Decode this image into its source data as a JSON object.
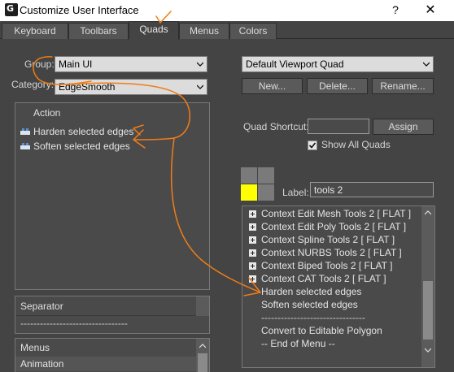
{
  "window": {
    "title": "Customize User Interface",
    "help_label": "?",
    "close_label": "✕"
  },
  "tabs": [
    {
      "label": "Keyboard"
    },
    {
      "label": "Toolbars"
    },
    {
      "label": "Quads",
      "active": true
    },
    {
      "label": "Menus"
    },
    {
      "label": "Colors"
    }
  ],
  "left": {
    "group_label": "Group:",
    "group_value": "Main UI",
    "category_label": "Category:",
    "category_value": "EdgeSmooth",
    "actions_header": "Action",
    "actions": [
      {
        "label": "Harden selected edges",
        "icon": "edge-icon"
      },
      {
        "label": "Soften selected edges",
        "icon": "edge-icon"
      }
    ],
    "separator_header": "Separator",
    "separator_line": "---------------------------------",
    "menus_header": "Menus",
    "menus_items": [
      "Animation"
    ]
  },
  "right": {
    "quad_dropdown_value": "Default Viewport Quad",
    "new_button": "New...",
    "delete_button": "Delete...",
    "rename_button": "Rename...",
    "quad_shortcut_label": "Quad Shortcut:",
    "quad_shortcut_value": "",
    "assign_button": "Assign",
    "show_all_quads_label": "Show All Quads",
    "show_all_quads_checked": true,
    "label_label": "Label:",
    "label_value": "tools 2",
    "quad_colors": {
      "active": "#ffff00",
      "inactive": "#7a7a7a"
    },
    "quad_items": [
      {
        "label": "Context Edit Mesh Tools 2 [ FLAT ]",
        "expandable": true
      },
      {
        "label": "Context Edit Poly Tools 2 [ FLAT ]",
        "expandable": true
      },
      {
        "label": "Context Spline Tools 2 [ FLAT ]",
        "expandable": true
      },
      {
        "label": "Context NURBS Tools 2 [ FLAT ]",
        "expandable": true
      },
      {
        "label": "Context Biped Tools 2 [ FLAT ]",
        "expandable": true
      },
      {
        "label": "Context CAT Tools 2 [ FLAT ]",
        "expandable": true
      },
      {
        "label": "Harden selected edges",
        "expandable": false
      },
      {
        "label": "Soften selected edges",
        "expandable": false
      },
      {
        "label": "--------------------------------",
        "expandable": false
      },
      {
        "label": "Convert to Editable Polygon",
        "expandable": false
      },
      {
        "label": "-- End of Menu --",
        "expandable": false
      }
    ]
  },
  "annotation_color": "#f07d16"
}
